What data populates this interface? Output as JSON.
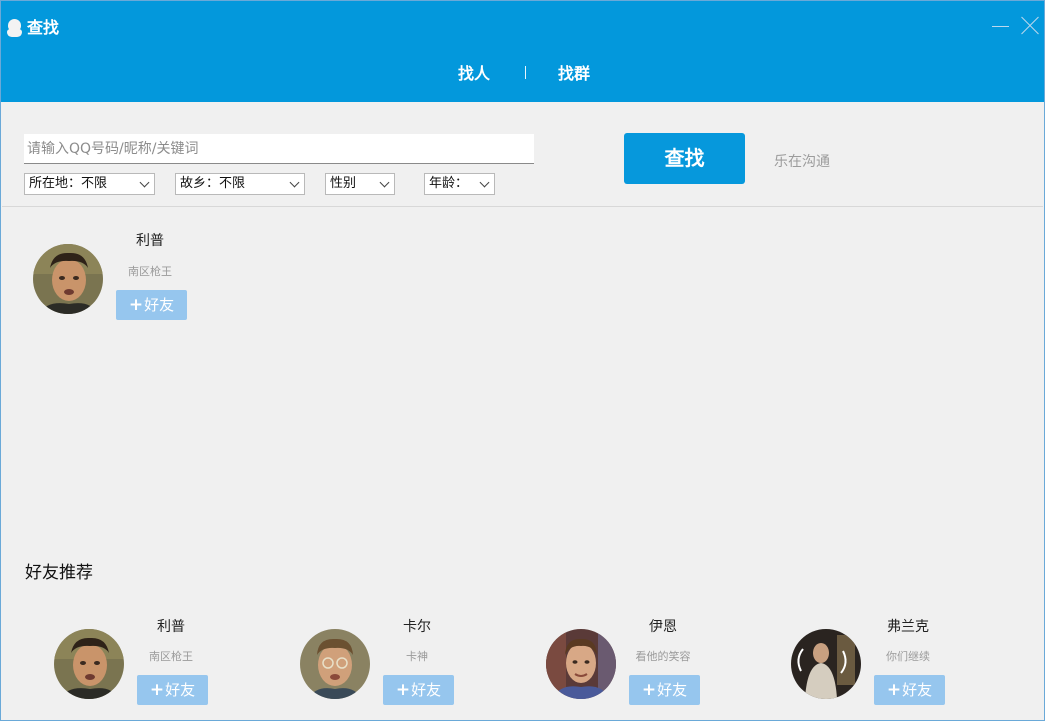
{
  "window": {
    "title": "查找",
    "tabs": [
      "找人",
      "找群"
    ]
  },
  "search": {
    "placeholder": "请输入QQ号码/昵称/关键词",
    "value": "",
    "button_label": "查找",
    "chat_link": "乐在沟通"
  },
  "filters": {
    "location": "所在地：不限",
    "hometown": "故乡：不限",
    "gender": "性别",
    "age": "年龄："
  },
  "result": {
    "name": "利普",
    "signature": "南区枪王",
    "add_label": "好友"
  },
  "recommend": {
    "title": "好友推荐",
    "items": [
      {
        "name": "利普",
        "signature": "南区枪王",
        "add_label": "好友"
      },
      {
        "name": "卡尔",
        "signature": "卡神",
        "add_label": "好友"
      },
      {
        "name": "伊恩",
        "signature": "看他的笑容",
        "add_label": "好友"
      },
      {
        "name": "弗兰克",
        "signature": "你们继续",
        "add_label": "好友"
      }
    ]
  },
  "icons": {
    "app": "qq-penguin-icon",
    "minimize": "minimize-icon",
    "close": "close-icon",
    "dropdown": "chevron-down-icon",
    "add": "plus-icon"
  },
  "colors": {
    "titlebar": "#0398dc",
    "search_button": "#0698dc",
    "add_button": "#96c6ee",
    "background": "#f0f0f0"
  }
}
